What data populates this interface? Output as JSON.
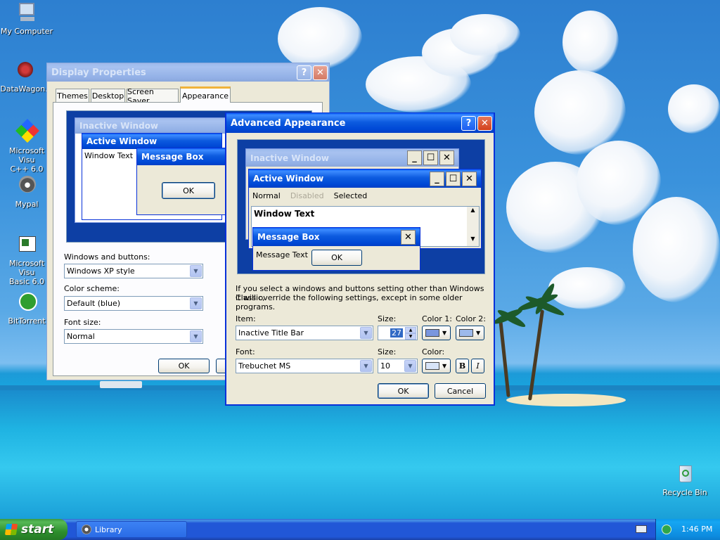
{
  "desktop_icons": [
    {
      "label": "My Computer",
      "icon": "computer-icon"
    },
    {
      "label": "DataWagon.",
      "icon": "datawagon-icon"
    },
    {
      "label": "Microsoft Visu C++ 6.0",
      "line1": "Microsoft Visu",
      "line2": "C++ 6.0",
      "icon": "visual-cpp-icon"
    },
    {
      "label": "Mypal",
      "icon": "mypal-icon"
    },
    {
      "label": "Microsoft Visu Basic 6.0",
      "line1": "Microsoft Visu",
      "line2": "Basic 6.0",
      "icon": "visual-basic-icon"
    },
    {
      "label": "BitTorrent",
      "icon": "bittorrent-icon"
    },
    {
      "label": "Recycle Bin",
      "icon": "recycle-bin-icon"
    }
  ],
  "display_properties": {
    "title": "Display Properties",
    "help_btn": "?",
    "tabs": [
      "Themes",
      "Desktop",
      "Screen Saver",
      "Appearance"
    ],
    "active_tab": "Appearance",
    "preview": {
      "inactive_title": "Inactive Window",
      "active_title": "Active Window",
      "window_text": "Window Text",
      "message_box_title": "Message Box",
      "ok": "OK"
    },
    "windows_buttons_label": "Windows and buttons:",
    "windows_buttons_value": "Windows XP style",
    "color_scheme_label": "Color scheme:",
    "color_scheme_value": "Default (blue)",
    "font_size_label": "Font size:",
    "font_size_value": "Normal",
    "ok": "OK"
  },
  "advanced_appearance": {
    "title": "Advanced Appearance",
    "help_btn": "?",
    "preview": {
      "inactive_title": "Inactive Window",
      "active_title": "Active Window",
      "menu_normal": "Normal",
      "menu_disabled": "Disabled",
      "menu_selected": "Selected",
      "window_text": "Window Text",
      "message_box_title": "Message Box",
      "message_text": "Message Text",
      "ok": "OK"
    },
    "info_line1": "If you select a windows and buttons setting other than Windows Classic,",
    "info_line2": "it will override the following settings, except in some older programs.",
    "item_label": "Item:",
    "item_value": "Inactive Title Bar",
    "size_label": "Size:",
    "size_value": "27",
    "color1_label": "Color 1:",
    "color2_label": "Color 2:",
    "font_label": "Font:",
    "font_value": "Trebuchet MS",
    "font_size_label": "Size:",
    "font_size_value": "10",
    "color_label": "Color:",
    "bold_btn": "B",
    "italic_btn": "I",
    "ok": "OK",
    "cancel": "Cancel",
    "color1_hex": "#7a96df",
    "color2_hex": "#9db9eb",
    "font_color_hex": "#d8e4f8"
  },
  "taskbar": {
    "start": "start",
    "task_library": "Library",
    "clock": "1:46 PM"
  },
  "colors": {
    "xp_blue": "#0054e3",
    "inactive_blue": "#9db9eb",
    "dialog_bg": "#ece9d8"
  }
}
